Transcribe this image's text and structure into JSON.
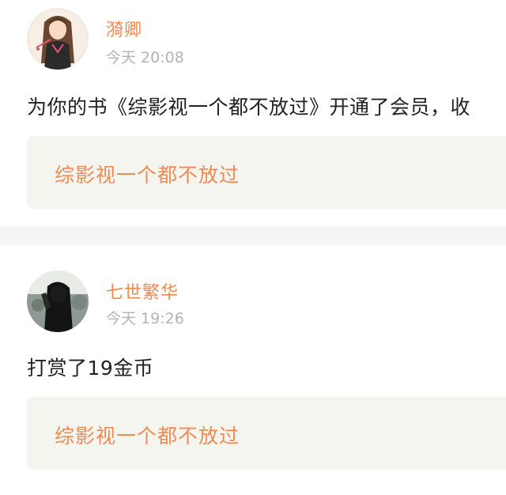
{
  "feed": {
    "items": [
      {
        "username": "漪卿",
        "timestamp": "今天 20:08",
        "message": "为你的书《综影视一个都不放过》开通了会员，收",
        "book_title": "综影视一个都不放过",
        "avatar": "girl-in-qipao-avatar"
      },
      {
        "username": "七世繁华",
        "timestamp": "今天 19:26",
        "message": "打赏了19金币",
        "book_title": "综影视一个都不放过",
        "avatar": "dark-haired-girl-avatar"
      }
    ]
  },
  "colors": {
    "accent": "#f08a52",
    "timestamp": "#b3b3b3",
    "text": "#222222",
    "book_box_bg": "#f5f5f0",
    "divider": "#f5f5f6"
  }
}
